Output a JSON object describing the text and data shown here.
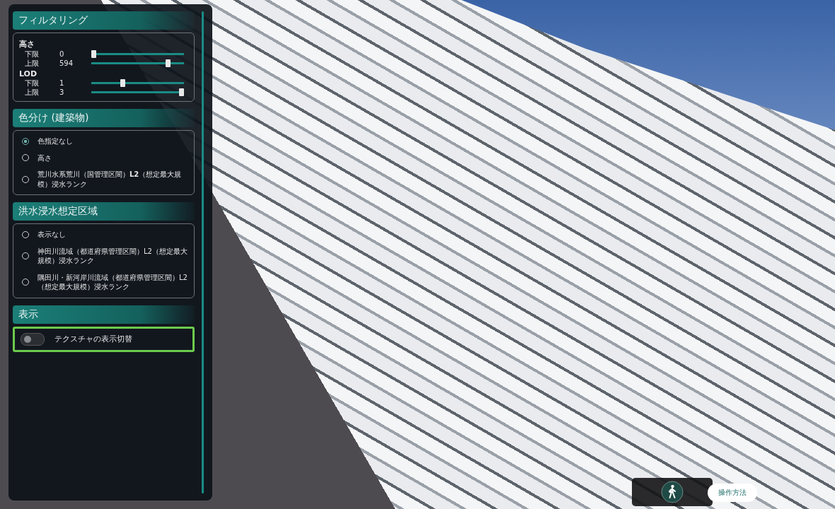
{
  "filter": {
    "title": "フィルタリング",
    "groups": [
      {
        "label": "高さ",
        "rows": [
          {
            "label": "下限",
            "reading": "0",
            "level": 0
          },
          {
            "label": "上限",
            "reading": "594",
            "level": 0.85
          }
        ]
      },
      {
        "label": "LOD",
        "rows": [
          {
            "label": "下限",
            "reading": "1",
            "level": 0.33
          },
          {
            "label": "上限",
            "reading": "3",
            "level": 1
          }
        ]
      }
    ]
  },
  "coloring": {
    "title": "色分け (建築物)",
    "options": [
      {
        "label": "色指定なし",
        "selected": true
      },
      {
        "label": "高さ",
        "selected": false
      },
      {
        "label": "荒川水系荒川（国管理区間）**L2**（想定最大規模）浸水ランク",
        "selected": false
      }
    ]
  },
  "flood": {
    "title": "洪水浸水想定区域",
    "options": [
      {
        "label": "表示なし",
        "selected": false
      },
      {
        "label": "神田川流域（都道府県管理区間）L2（想定最大規模）浸水ランク",
        "selected": false
      },
      {
        "label": "隅田川・新河岸川流域（都道府県管理区間）L2（想定最大規模）浸水ランク",
        "selected": false
      }
    ]
  },
  "display": {
    "title": "表示",
    "toggle": {
      "label": "テクスチャの表示切替",
      "on": false,
      "highlighted": true
    }
  },
  "controls": {
    "help_button": "操作方法"
  }
}
